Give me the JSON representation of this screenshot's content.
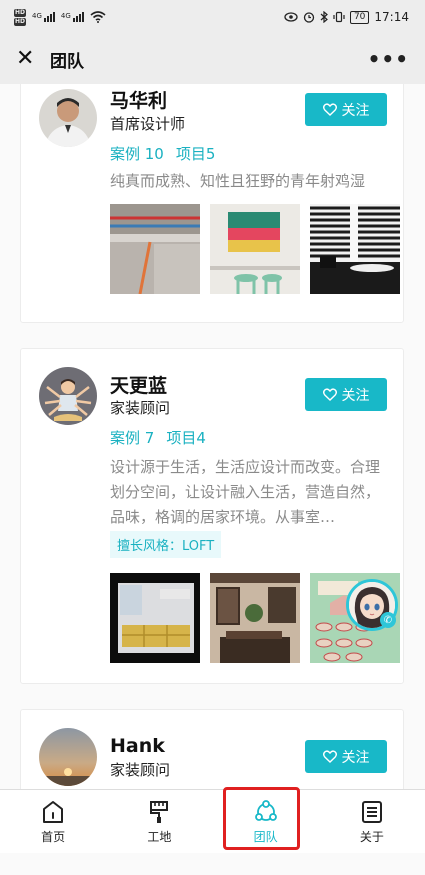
{
  "status_bar": {
    "left": [
      "HD",
      "HD",
      "4G",
      "4G"
    ],
    "battery": "70",
    "time": "17:14"
  },
  "nav": {
    "title": "团队",
    "more": "•••"
  },
  "designers": [
    {
      "name": "马华利",
      "role": "首席设计师",
      "follow": "关注",
      "cases": "案例 10",
      "projects": "项目5",
      "intro": "纯真而成熟、知性且狂野的青年射鸡湿"
    },
    {
      "name": "天更蓝",
      "role": "家装顾问",
      "follow": "关注",
      "cases": "案例 7",
      "projects": "项目4",
      "intro": "设计源于生活，生活应设计而改变。合理划分空间，让设计融入生活，营造自然，品味，格调的居家环境。从事室…",
      "style_tag": "擅长风格：LOFT"
    },
    {
      "name": "Hank",
      "role": "家装顾问",
      "follow": "关注"
    }
  ],
  "tabs": [
    {
      "label": "首页",
      "icon": "home-icon"
    },
    {
      "label": "工地",
      "icon": "paint-brush-icon"
    },
    {
      "label": "团队",
      "icon": "team-icon",
      "active": true
    },
    {
      "label": "关于",
      "icon": "document-icon"
    }
  ],
  "colors": {
    "accent": "#18b8c8",
    "highlight": "#e02020"
  }
}
